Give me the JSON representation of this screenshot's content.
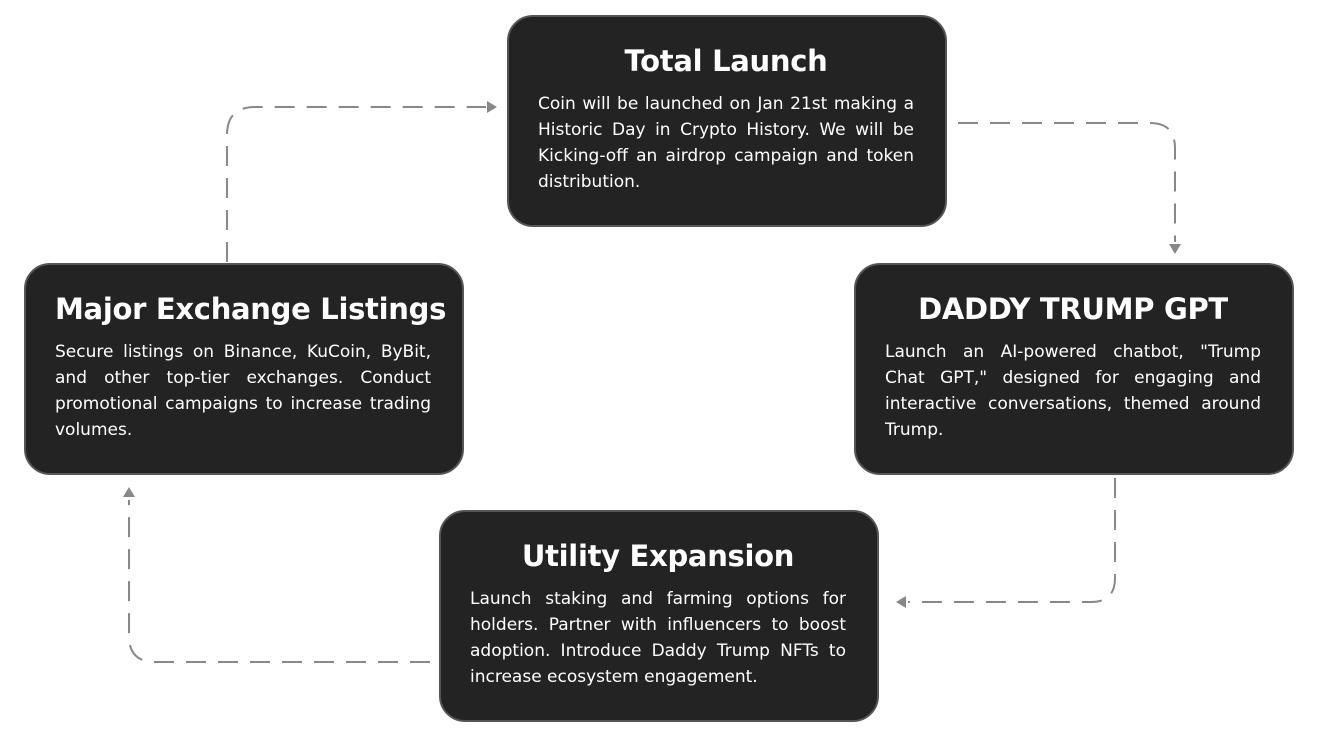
{
  "cards": {
    "total_launch": {
      "title": "Total Launch",
      "body": "Coin will be launched on Jan 21st making a Historic Day in Crypto History. We will be Kicking-off an airdrop campaign and token distribution."
    },
    "daddy_trump_gpt": {
      "title": "DADDY TRUMP GPT",
      "body": "Launch an AI-powered chatbot, \"Trump Chat GPT,\" designed for engaging and interactive conversations, themed around Trump."
    },
    "utility_expansion": {
      "title": "Utility Expansion",
      "body": "Launch staking and farming options for holders. Partner with influencers to boost adoption. Introduce Daddy Trump NFTs to increase ecosystem engagement."
    },
    "major_exchange_listings": {
      "title": "Major Exchange Listings",
      "body": "Secure listings on Binance, KuCoin, ByBit, and other top-tier exchanges. Conduct promotional campaigns to increase trading volumes."
    }
  },
  "colors": {
    "card_background": "#232323",
    "card_border": "#555555",
    "card_text": "#ffffff",
    "connector": "#888888",
    "page_background": "#ffffff"
  }
}
